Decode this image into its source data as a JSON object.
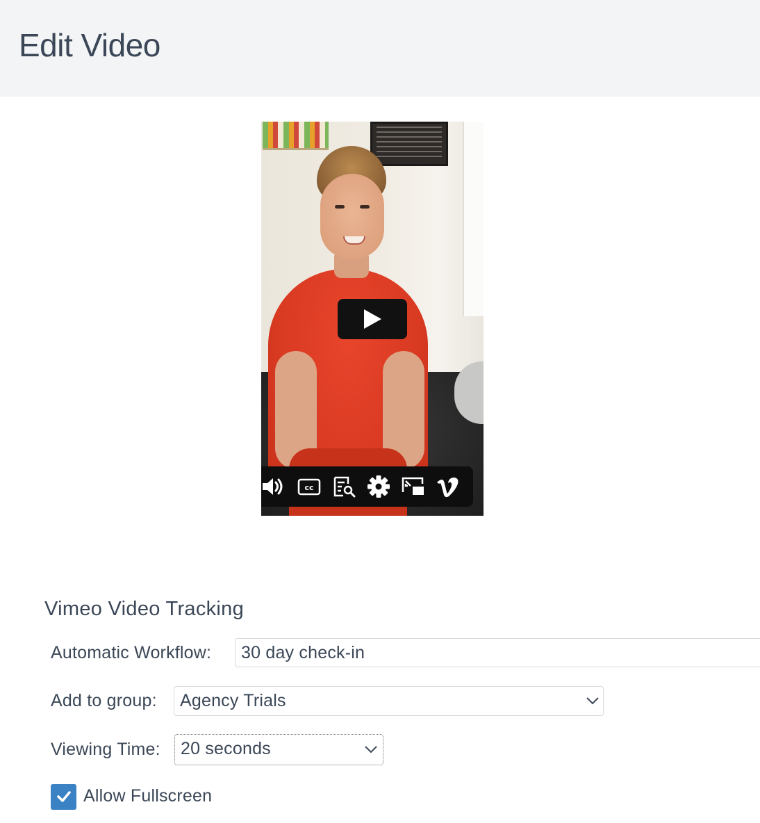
{
  "header": {
    "title": "Edit Video"
  },
  "video": {
    "controls": {
      "volume": "volume-icon",
      "captions": "cc",
      "transcript": "transcript-search-icon",
      "settings": "gear-icon",
      "pip": "picture-in-picture-icon",
      "brand": "vimeo-logo-icon"
    }
  },
  "form": {
    "section_title": "Vimeo Video Tracking",
    "workflow": {
      "label": "Automatic Workflow:",
      "value": "30 day check-in"
    },
    "group": {
      "label": "Add to group:",
      "value": "Agency Trials"
    },
    "viewing_time": {
      "label": "Viewing Time:",
      "value": "20 seconds"
    },
    "fullscreen": {
      "label": "Allow Fullscreen",
      "checked": true
    }
  },
  "colors": {
    "header_bg": "#f3f4f6",
    "text": "#3b4757",
    "checkbox": "#3b82c4",
    "border": "#d5d8dd"
  }
}
